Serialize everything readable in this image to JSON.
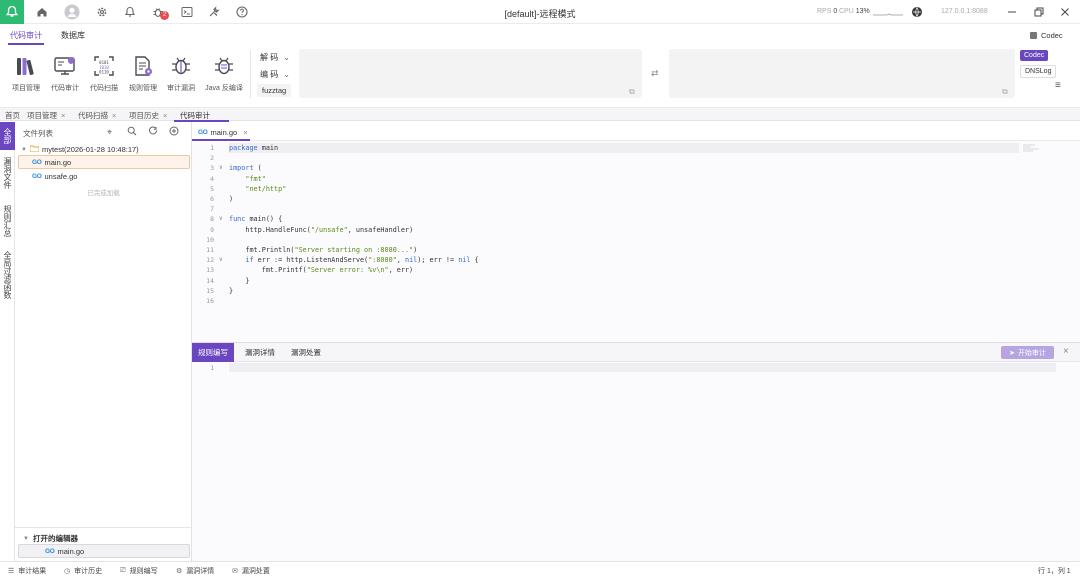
{
  "titlebar": {
    "title": "[default]-远程模式",
    "notification_badge": "2",
    "rps_label": "RPS",
    "rps_value": "0",
    "cpu_label": "CPU",
    "cpu_value": "13%",
    "address": "127.0.0.1:8088"
  },
  "menubar": {
    "items": [
      "代码审计",
      "数据库"
    ],
    "codec_top": "Codec"
  },
  "toolbar": {
    "tools": [
      "项目管理",
      "代码审计",
      "代码扫描",
      "规则管理",
      "审计漏洞",
      "Java 反编译"
    ],
    "decode_label": "解 码",
    "encode_label": "编 码",
    "fuzztag_label": "fuzztag",
    "side_buttons": [
      "Codec",
      "DNSLog"
    ]
  },
  "tabs": [
    {
      "label": "首页",
      "closable": false
    },
    {
      "label": "项目管理",
      "closable": true
    },
    {
      "label": "代码扫描",
      "closable": true
    },
    {
      "label": "项目历史",
      "closable": true
    },
    {
      "label": "代码审计",
      "closable": false,
      "active": true
    }
  ],
  "rail": {
    "items": [
      "全部",
      "漏洞文件",
      "规则汇总",
      "全局过滤函数"
    ]
  },
  "file_panel": {
    "title": "文件列表",
    "project": "mytest(2026-01-28 10:48:17)",
    "files": [
      "main.go",
      "unsafe.go"
    ],
    "loaded_hint": "已完成加载",
    "open_editors_title": "打开的编辑器",
    "open_editor_file": "main.go",
    "go_badge": "GO"
  },
  "editor": {
    "tab_label": "main.go",
    "line_numbers": [
      "1",
      "2",
      "3",
      "4",
      "5",
      "6",
      "7",
      "8",
      "9",
      "10",
      "11",
      "12",
      "13",
      "14",
      "15",
      "16"
    ],
    "code_lines": [
      "package main",
      "",
      "import (",
      "    \"fmt\"",
      "    \"net/http\"",
      ")",
      "",
      "func main() {",
      "    http.HandleFunc(\"/unsafe\", unsafeHandler)",
      "",
      "    fmt.Println(\"Server starting on :8080...\")",
      "    if err := http.ListenAndServe(\":8080\", nil); err != nil {",
      "        fmt.Printf(\"Server error: %v\\n\", err)",
      "    }",
      "}",
      ""
    ]
  },
  "bottom_panel": {
    "tabs": [
      "规则编写",
      "漏洞详情",
      "漏洞处置"
    ],
    "run_button": "开始审计",
    "line_number": "1"
  },
  "statusbar": {
    "items": [
      "审计结果",
      "审计历史",
      "规则编写",
      "漏洞详情",
      "漏洞处置"
    ],
    "cursor": "行 1，列 1"
  },
  "colors": {
    "accent": "#6b46c1",
    "logo_green": "#2dbb74",
    "badge_red": "#e94d4d"
  }
}
